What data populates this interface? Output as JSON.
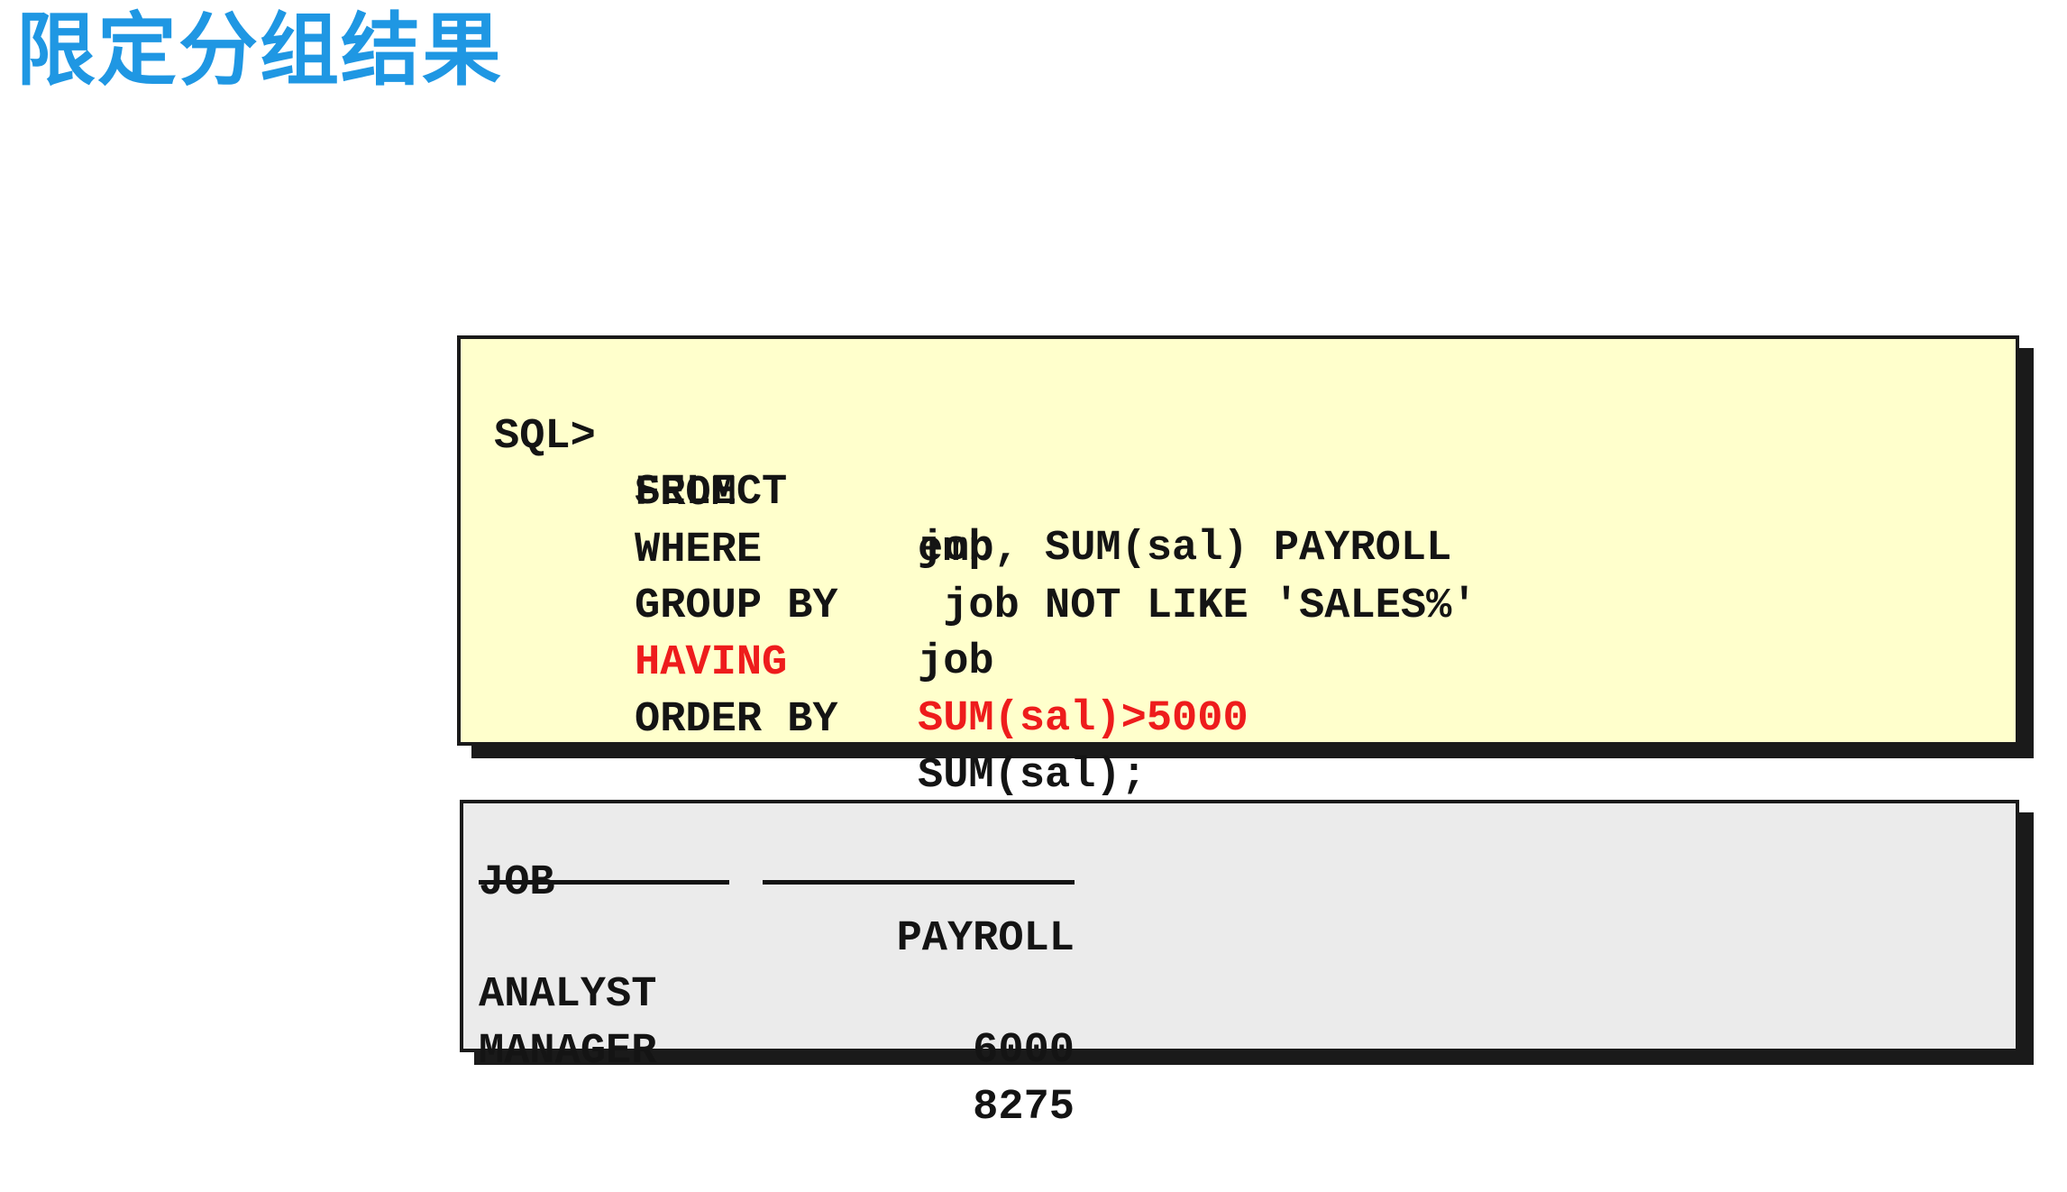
{
  "slide": {
    "title": "限定分组结果"
  },
  "sql": {
    "prompt": "SQL>",
    "lines": [
      {
        "keyword": "SELECT",
        "expr": "job, SUM(sal) PAYROLL"
      },
      {
        "keyword": "FROM",
        "expr": "emp"
      },
      {
        "keyword": "WHERE",
        "expr": " job NOT LIKE 'SALES%'"
      },
      {
        "keyword": "GROUP BY",
        "expr": "job"
      },
      {
        "keyword": "HAVING",
        "expr": "SUM(sal)>5000"
      },
      {
        "keyword": "ORDER BY",
        "expr": "SUM(sal);"
      }
    ],
    "highlight_color": "#ee1c1c"
  },
  "result": {
    "headers": [
      "JOB",
      "PAYROLL"
    ],
    "rows": [
      {
        "job": "ANALYST",
        "payroll": "6000"
      },
      {
        "job": "MANAGER",
        "payroll": "8275"
      }
    ]
  },
  "colors": {
    "title": "#1f97e3",
    "sql_background": "#ffffcc",
    "result_background": "#ebebeb"
  }
}
